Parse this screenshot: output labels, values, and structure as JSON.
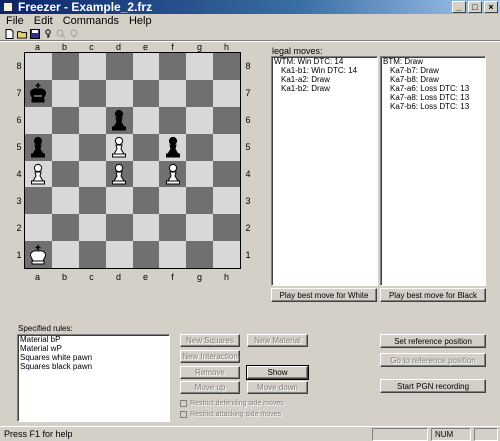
{
  "window": {
    "title": "Freezer - Example_2.frz"
  },
  "menu": [
    "File",
    "Edit",
    "Commands",
    "Help"
  ],
  "toolbar_icons": [
    "new-file-icon",
    "open-folder-icon",
    "save-disk-icon",
    "key-icon",
    "find-disabled-icon",
    "search-disabled-icon"
  ],
  "board": {
    "files": [
      "a",
      "b",
      "c",
      "d",
      "e",
      "f",
      "g",
      "h"
    ],
    "ranks": [
      "8",
      "7",
      "6",
      "5",
      "4",
      "3",
      "2",
      "1"
    ],
    "pieces": [
      {
        "square": "a7",
        "piece": "black-king"
      },
      {
        "square": "a5",
        "piece": "black-pawn"
      },
      {
        "square": "a4",
        "piece": "white-pawn"
      },
      {
        "square": "a1",
        "piece": "white-king"
      },
      {
        "square": "d6",
        "piece": "black-pawn"
      },
      {
        "square": "d5",
        "piece": "white-pawn"
      },
      {
        "square": "d4",
        "piece": "white-pawn"
      },
      {
        "square": "f5",
        "piece": "black-pawn"
      },
      {
        "square": "f4",
        "piece": "white-pawn"
      }
    ]
  },
  "legal_moves": {
    "label": "legal moves:",
    "white": {
      "header": "WTM: Win DTC: 14",
      "moves": [
        "Ka1-b1: Win DTC: 14",
        "Ka1-a2: Draw",
        "Ka1-b2: Draw"
      ]
    },
    "black": {
      "header": "BTM: Draw",
      "moves": [
        "Ka7-b7: Draw",
        "Ka7-b8: Draw",
        "Ka7-a6: Loss DTC: 13",
        "Ka7-a8: Loss DTC: 13",
        "Ka7-b6: Loss DTC: 13"
      ]
    },
    "best_white_label": "Play best move for White",
    "best_black_label": "Play best move for Black"
  },
  "rules": {
    "label": "Specified rules:",
    "items": [
      "Material bP",
      "Material wP",
      "Squares white pawn",
      "Squares black pawn"
    ]
  },
  "rule_buttons": {
    "new_squares": "New Squares",
    "new_material": "New Material",
    "new_interaction": "New Interaction",
    "remove": "Remove",
    "show": "Show",
    "move_up": "Move up",
    "move_down": "Move down"
  },
  "checkboxes": {
    "cb1": "Restrict defending side moves",
    "cb2": "Restrict attacking side moves"
  },
  "right_buttons": {
    "set_reference": "Set reference position",
    "go_to_reference": "Go to reference position",
    "start_pgn": "Start PGN recording"
  },
  "status": {
    "text": "Press F1 for help",
    "num": "NUM"
  }
}
